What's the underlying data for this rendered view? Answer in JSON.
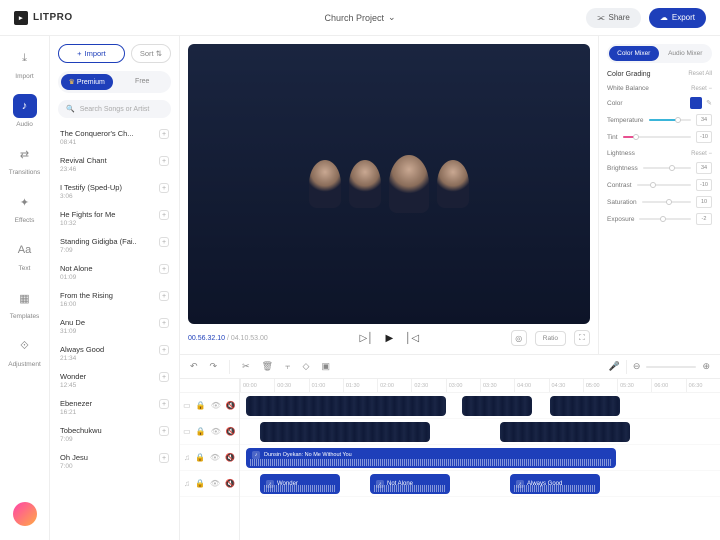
{
  "brand": "LITPRO",
  "project": "Church Project",
  "header": {
    "share": "Share",
    "export": "Export"
  },
  "nav": [
    {
      "label": "Import",
      "icon": "⤓"
    },
    {
      "label": "Audio",
      "icon": "♪",
      "active": true
    },
    {
      "label": "Transitions",
      "icon": "⇄"
    },
    {
      "label": "Effects",
      "icon": "✦"
    },
    {
      "label": "Text",
      "icon": "Aa"
    },
    {
      "label": "Templates",
      "icon": "▦"
    },
    {
      "label": "Adjustment",
      "icon": "⟐"
    }
  ],
  "panel": {
    "import": "Import",
    "sort": "Sort",
    "tabs": {
      "premium": "Premium",
      "free": "Free"
    },
    "search_ph": "Search Songs or Artist",
    "songs": [
      {
        "t": "The Conqueror's Ch...",
        "d": "08:41"
      },
      {
        "t": "Revival Chant",
        "d": "23:46"
      },
      {
        "t": "I Testify (Sped-Up)",
        "d": "3:06"
      },
      {
        "t": "He Fights for Me",
        "d": "10:32"
      },
      {
        "t": "Standing Gidigba (Fai..",
        "d": "7:09"
      },
      {
        "t": "Not Alone",
        "d": "01:09"
      },
      {
        "t": "From the Rising",
        "d": "16:00"
      },
      {
        "t": "Anu De",
        "d": "31:09"
      },
      {
        "t": "Always Good",
        "d": "21:34"
      },
      {
        "t": "Wonder",
        "d": "12:45"
      },
      {
        "t": "Ebenezer",
        "d": "16:21"
      },
      {
        "t": "Tobechukwu",
        "d": "7:09"
      },
      {
        "t": "Oh Jesu",
        "d": "7:00"
      }
    ]
  },
  "preview": {
    "time_cur": "00.56.32.10",
    "time_tot": "04.10.53.00",
    "ratio": "Ratio"
  },
  "mixer": {
    "tabs": {
      "color": "Color Mixer",
      "audio": "Audio Mixer"
    },
    "grading": "Color Grading",
    "reset_all": "Reset All",
    "white_balance": "White Balance",
    "reset": "Reset",
    "color": "Color",
    "temperature": {
      "label": "Temperature",
      "val": "34"
    },
    "tint": {
      "label": "Tint",
      "val": "-10"
    },
    "lightness": "Lightness",
    "brightness": {
      "label": "Brightness",
      "val": "34"
    },
    "contrast": {
      "label": "Contrast",
      "val": "-10"
    },
    "saturation": {
      "label": "Saturation",
      "val": "10"
    },
    "exposure": {
      "label": "Exposure",
      "val": "-2"
    }
  },
  "ruler": [
    "00:00",
    "00:30",
    "01:00",
    "01:30",
    "02:00",
    "02:30",
    "03:00",
    "03:30",
    "04:00",
    "04:30",
    "05:00",
    "05:30",
    "06:00",
    "06:30"
  ],
  "tracks": {
    "audio_main": "Dunsin Oyekan: No Me Without You",
    "a1": "Wonder",
    "a2": "Not Alone",
    "a3": "Always Good"
  }
}
